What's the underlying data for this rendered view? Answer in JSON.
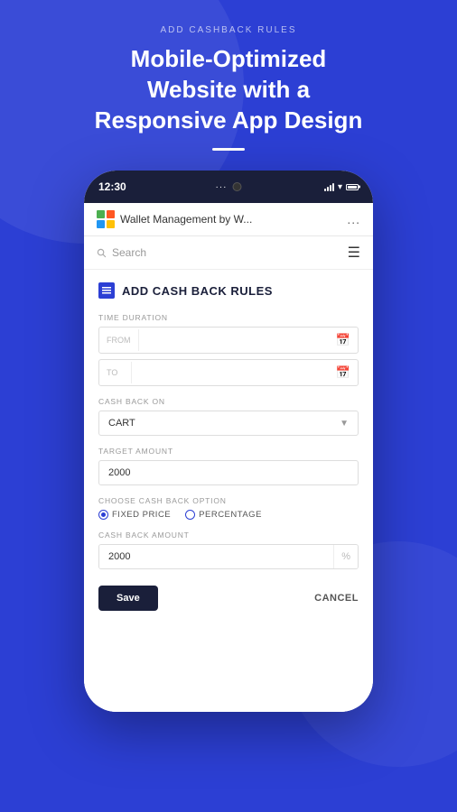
{
  "page": {
    "subtitle": "ADD CASHBACK RULES",
    "main_title_line1": "Mobile-Optimized Website with a",
    "main_title_line2": "Responsive App Design"
  },
  "status_bar": {
    "time": "12:30"
  },
  "app_bar": {
    "title": "Wallet Management by W...",
    "menu_dots": "..."
  },
  "search": {
    "placeholder": "Search"
  },
  "form": {
    "heading": "ADD CASH BACK RULES",
    "time_duration_label": "TIME DURATION",
    "from_label": "FROM",
    "to_label": "TO",
    "cashback_on_label": "CASH BACK ON",
    "cashback_on_value": "CART",
    "target_amount_label": "TARGET AMOUNT",
    "target_amount_value": "2000",
    "choose_option_label": "CHOOSE CASH BACK OPTION",
    "radio_fixed": "FIXED PRICE",
    "radio_percentage": "PERCENTAGE",
    "cashback_amount_label": "CASH BACK  AMOUNT",
    "cashback_amount_value": "2000",
    "amount_suffix": "%",
    "save_label": "Save",
    "cancel_label": "CANCEL"
  }
}
